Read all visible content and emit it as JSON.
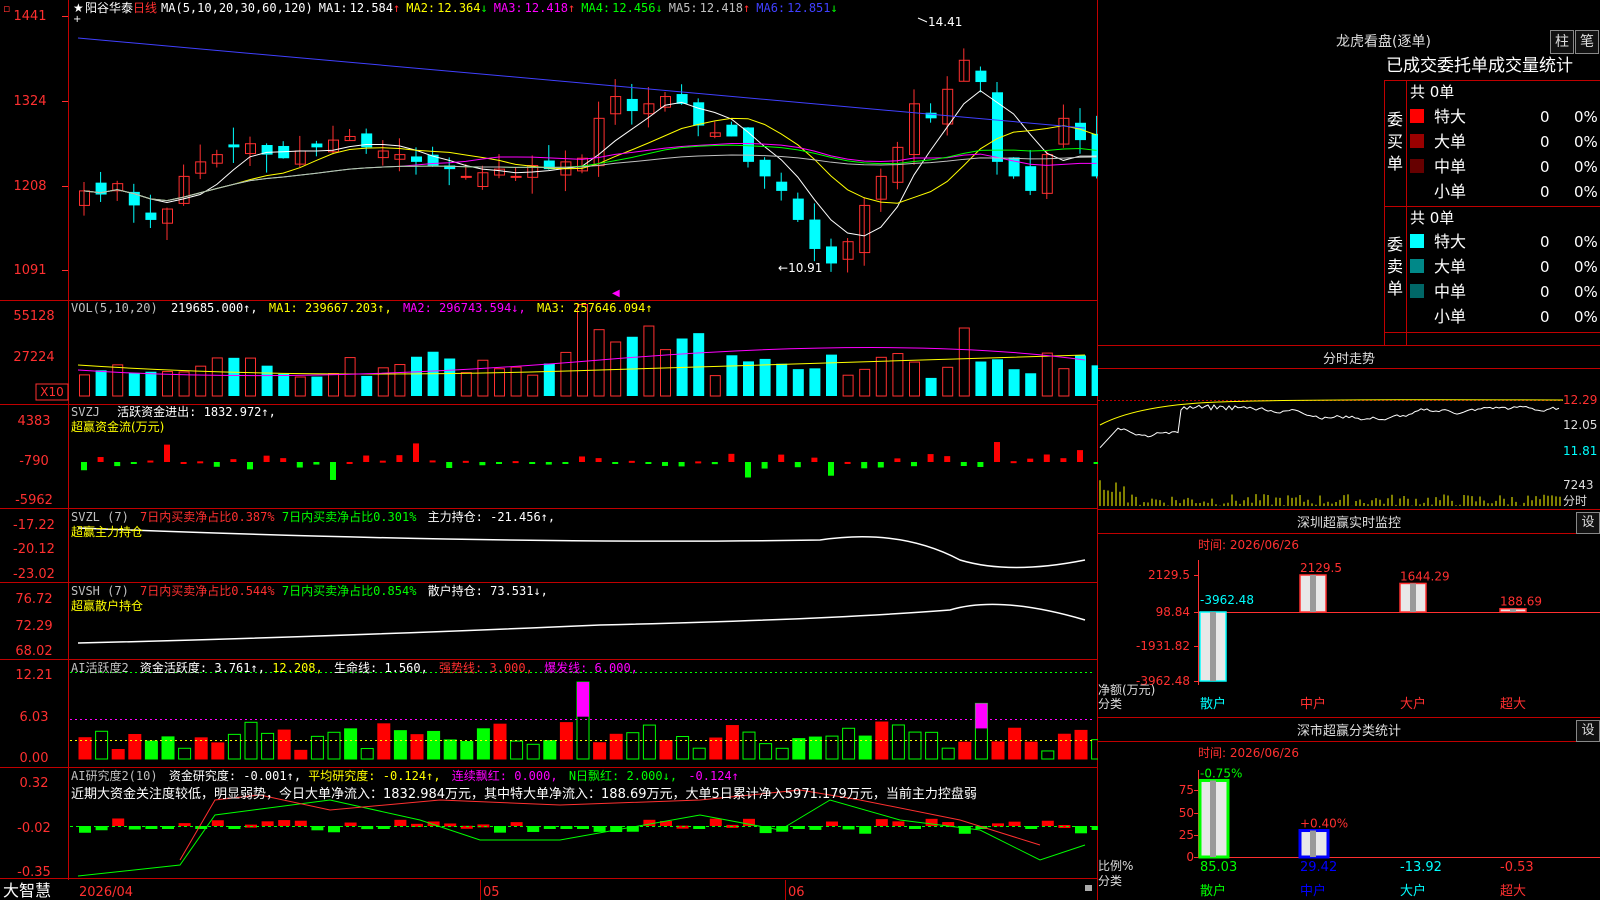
{
  "app": {
    "brand": "大智慧"
  },
  "header": {
    "stock_name": "阳谷华泰",
    "period": "日线",
    "ma_params": "MA(5,10,20,30,60,120)",
    "ma": [
      {
        "label": "MA1:",
        "value": "12.584",
        "dir": "↑",
        "color": "#ffffff"
      },
      {
        "label": "MA2:",
        "value": "12.364",
        "dir": "↓",
        "color": "#ffff00"
      },
      {
        "label": "MA3:",
        "value": "12.418",
        "dir": "↑",
        "color": "#ff00ff"
      },
      {
        "label": "MA4:",
        "value": "12.456",
        "dir": "↓",
        "color": "#00ff00"
      },
      {
        "label": "MA5:",
        "value": "12.418",
        "dir": "↑",
        "color": "#c0c0c0"
      },
      {
        "label": "MA6:",
        "value": "12.851",
        "dir": "↓",
        "color": "#4040ff"
      }
    ]
  },
  "price_axis": [
    "1441",
    "1324",
    "1208",
    "1091"
  ],
  "price_labels": {
    "high": "14.41",
    "low": "10.91"
  },
  "vol": {
    "title": "VOL(5,10,20)",
    "value": "219685.000↑,",
    "ma1": "MA1: 239667.203↑,",
    "ma2": "MA2: 296743.594↓,",
    "ma3": "MA3: 257646.094↑",
    "axis": [
      "55128",
      "27224"
    ],
    "unit": "X10"
  },
  "svzj": {
    "title": "SVZJ",
    "text": "活跃资金进出: 1832.972↑,",
    "sub": "超赢资金流(万元)",
    "axis": [
      "4383",
      "-790",
      "-5962"
    ]
  },
  "svzl": {
    "title": "SVZL (7)",
    "t1": "7日内买卖净占比0.387%",
    "t2": "7日内买卖净占比0.301%",
    "t3": "主力持仓: -21.456↑,",
    "sub": "超赢主力持仓",
    "axis": [
      "-17.22",
      "-20.12",
      "-23.02"
    ]
  },
  "svsh": {
    "title": "SVSH (7)",
    "t1": "7日内买卖净占比0.544%",
    "t2": "7日内买卖净占比0.854%",
    "t3": "散户持仓: 73.531↓,",
    "sub": "超赢散户持仓",
    "axis": [
      "76.72",
      "72.29",
      "68.02"
    ]
  },
  "ai1": {
    "title": "AI活跃度2",
    "t1": "资金活跃度: 3.761↑,",
    "t2": "12.208,",
    "t3": "生命线: 1.560,",
    "t4": "强势线: 3.000,",
    "t5": "爆发线: 6.000,",
    "axis": [
      "12.21",
      "6.03",
      "0.00"
    ]
  },
  "ai2": {
    "title": "AI研究度2(10)",
    "t1": "资金研究度: -0.001↑,",
    "t2": "平均研究度: -0.124↑,",
    "t3": "连续飘红: 0.000,",
    "t4": "N日飘红: 2.000↓,",
    "t5": "-0.124↑",
    "comment": "近期大资金关注度较低，明显弱势，今日大单净流入：1832.984万元，其中特大单净流入：188.69万元，大单5日累计净入5971.179万元，当前主力控盘弱",
    "axis": [
      "0.32",
      "-0.02",
      "-0.35"
    ]
  },
  "date_axis": [
    "2026/04",
    "05",
    "06"
  ],
  "right": {
    "lhb_title": "龙虎看盘(逐单)",
    "btn_zhu": "柱",
    "btn_bi": "笔",
    "order_title": "已成交委托单成交量统计",
    "buy": {
      "label": "委买单",
      "total": "共 0单",
      "rows": [
        {
          "name": "特大",
          "n": "0",
          "p": "0%",
          "color": "#ff0000"
        },
        {
          "name": "大单",
          "n": "0",
          "p": "0%",
          "color": "#990000"
        },
        {
          "name": "中单",
          "n": "0",
          "p": "0%",
          "color": "#660000"
        },
        {
          "name": "小单",
          "n": "0",
          "p": "0%",
          "color": ""
        }
      ]
    },
    "sell": {
      "label": "委卖单",
      "total": "共 0单",
      "rows": [
        {
          "name": "特大",
          "n": "0",
          "p": "0%",
          "color": "#00ffff"
        },
        {
          "name": "大单",
          "n": "0",
          "p": "0%",
          "color": "#008888"
        },
        {
          "name": "中单",
          "n": "0",
          "p": "0%",
          "color": "#006666"
        },
        {
          "name": "小单",
          "n": "0",
          "p": "0%",
          "color": ""
        }
      ]
    },
    "intraday_title": "分时走势",
    "intraday_axis": [
      "12.29",
      "12.05",
      "11.81"
    ],
    "intraday_vol": "7243",
    "intraday_label": "分时",
    "sz_title": "深圳超赢实时监控",
    "sz_set": "设",
    "sz_time": "时间: 2026/06/26",
    "sz_axis": [
      "2129.5",
      "98.84",
      "-1931.82",
      "-3962.48"
    ],
    "sz_bars": [
      {
        "cat": "散户",
        "value": "-3962.48"
      },
      {
        "cat": "中户",
        "value": "2129.5"
      },
      {
        "cat": "大户",
        "value": "1644.29"
      },
      {
        "cat": "超大",
        "value": "188.69"
      }
    ],
    "sz_ylabel": "净额(万元)",
    "sz_xlabel": "分类",
    "cls_title": "深市超赢分类统计",
    "cls_set": "设",
    "cls_time": "时间: 2026/06/26",
    "cls_axis": [
      "75",
      "50",
      "25",
      "0"
    ],
    "cls_top": [
      "-0.75%",
      "+0.40%"
    ],
    "cls_values": [
      "85.03",
      "29.42",
      "-13.92",
      "-0.53"
    ],
    "cls_cats": [
      "散户",
      "中户",
      "大户",
      "超大"
    ],
    "cls_ylabel": "比例%",
    "cls_xlabel": "分类"
  }
}
